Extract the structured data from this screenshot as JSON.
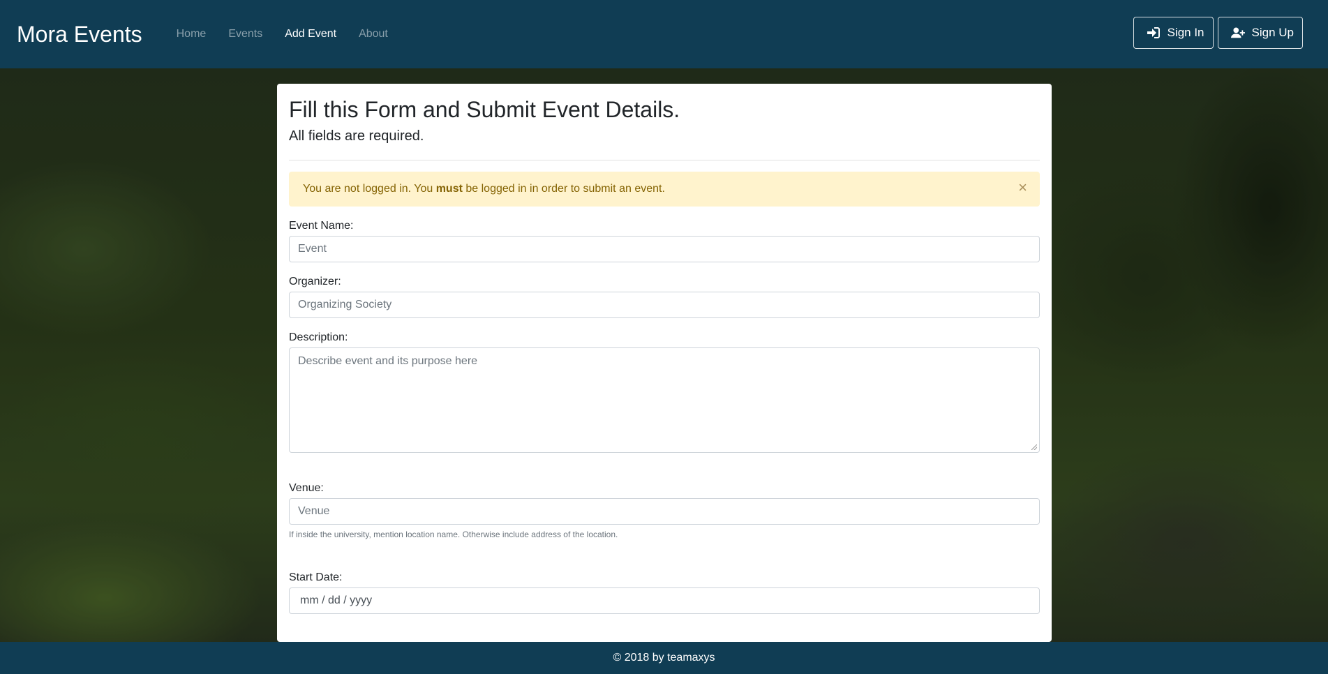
{
  "navbar": {
    "brand": "Mora Events",
    "links": [
      {
        "label": "Home",
        "active": false
      },
      {
        "label": "Events",
        "active": false
      },
      {
        "label": "Add Event",
        "active": true
      },
      {
        "label": "About",
        "active": false
      }
    ],
    "sign_in": "Sign In",
    "sign_up": "Sign Up",
    "bg_color": "#103d54"
  },
  "form": {
    "title": "Fill this Form and Submit Event Details.",
    "subtitle": "All fields are required.",
    "alert": {
      "before": "You are not logged in. You ",
      "bold": "must",
      "after": " be logged in in order to submit an event.",
      "close": "×"
    },
    "event_name": {
      "label": "Event Name:",
      "placeholder": "Event"
    },
    "organizer": {
      "label": "Organizer:",
      "placeholder": "Organizing Society"
    },
    "description": {
      "label": "Description:",
      "placeholder": "Describe event and its purpose here"
    },
    "venue": {
      "label": "Venue:",
      "placeholder": "Venue",
      "help": "If inside the university, mention location name. Otherwise include address of the location."
    },
    "start_date": {
      "label": "Start Date:",
      "placeholder": "mm / dd / yyyy"
    }
  },
  "footer": {
    "text": "© 2018 by teamaxys"
  }
}
